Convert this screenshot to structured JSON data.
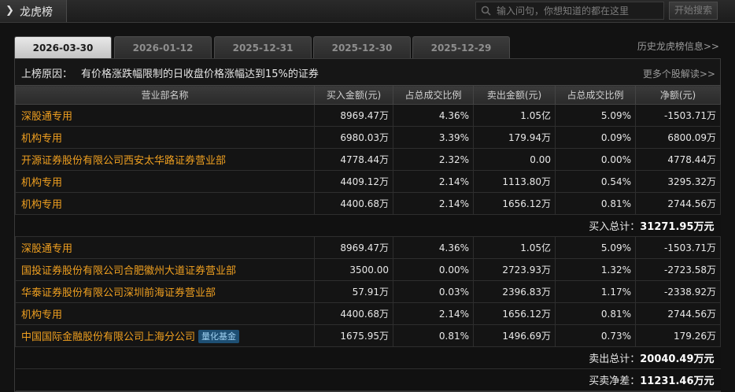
{
  "window": {
    "title": "龙虎榜"
  },
  "search": {
    "placeholder": "输入问句，你想知道的都在这里",
    "button_label": "开始搜索"
  },
  "tabs": [
    {
      "label": "2026-03-30",
      "active": true
    },
    {
      "label": "2026-01-12",
      "active": false
    },
    {
      "label": "2025-12-31",
      "active": false
    },
    {
      "label": "2025-12-30",
      "active": false
    },
    {
      "label": "2025-12-29",
      "active": false
    }
  ],
  "history_link": "历史龙虎榜信息>>",
  "reason": {
    "label": "上榜原因：",
    "text": "有价格涨跌幅限制的日收盘价格涨幅达到15%的证券"
  },
  "more_link": "更多个股解读>>",
  "columns": [
    "营业部名称",
    "买入金额(元)",
    "占总成交比例",
    "卖出金额(元)",
    "占总成交比例",
    "净额(元)"
  ],
  "buy_rows": [
    {
      "name": "深股通专用",
      "buy": "8969.47万",
      "buy_pct": "4.36%",
      "sell": "1.05亿",
      "sell_pct": "5.09%",
      "net": "-1503.71万"
    },
    {
      "name": "机构专用",
      "buy": "6980.03万",
      "buy_pct": "3.39%",
      "sell": "179.94万",
      "sell_pct": "0.09%",
      "net": "6800.09万"
    },
    {
      "name": "开源证券股份有限公司西安太华路证券营业部",
      "buy": "4778.44万",
      "buy_pct": "2.32%",
      "sell": "0.00",
      "sell_pct": "0.00%",
      "net": "4778.44万"
    },
    {
      "name": "机构专用",
      "buy": "4409.12万",
      "buy_pct": "2.14%",
      "sell": "1113.80万",
      "sell_pct": "0.54%",
      "net": "3295.32万"
    },
    {
      "name": "机构专用",
      "buy": "4400.68万",
      "buy_pct": "2.14%",
      "sell": "1656.12万",
      "sell_pct": "0.81%",
      "net": "2744.56万"
    }
  ],
  "buy_total": {
    "label": "买入总计：",
    "value": "31271.95万元"
  },
  "sell_rows": [
    {
      "name": "深股通专用",
      "buy": "8969.47万",
      "buy_pct": "4.36%",
      "sell": "1.05亿",
      "sell_pct": "5.09%",
      "net": "-1503.71万"
    },
    {
      "name": "国投证券股份有限公司合肥徽州大道证券营业部",
      "buy": "3500.00",
      "buy_pct": "0.00%",
      "sell": "2723.93万",
      "sell_pct": "1.32%",
      "net": "-2723.58万"
    },
    {
      "name": "华泰证券股份有限公司深圳前海证券营业部",
      "buy": "57.91万",
      "buy_pct": "0.03%",
      "sell": "2396.83万",
      "sell_pct": "1.17%",
      "net": "-2338.92万"
    },
    {
      "name": "机构专用",
      "buy": "4400.68万",
      "buy_pct": "2.14%",
      "sell": "1656.12万",
      "sell_pct": "0.81%",
      "net": "2744.56万"
    },
    {
      "name": "中国国际金融股份有限公司上海分公司",
      "badge": "量化基金",
      "buy": "1675.95万",
      "buy_pct": "0.81%",
      "sell": "1496.69万",
      "sell_pct": "0.73%",
      "net": "179.26万"
    }
  ],
  "sell_total": {
    "label": "卖出总计：",
    "value": "20040.49万元"
  },
  "net_total": {
    "label": "买卖净差：",
    "value": "11231.46万元"
  },
  "colors": {
    "name_text": "#f0a020",
    "badge_bg": "#1e4f73",
    "active_tab": "#d8d8d8"
  }
}
